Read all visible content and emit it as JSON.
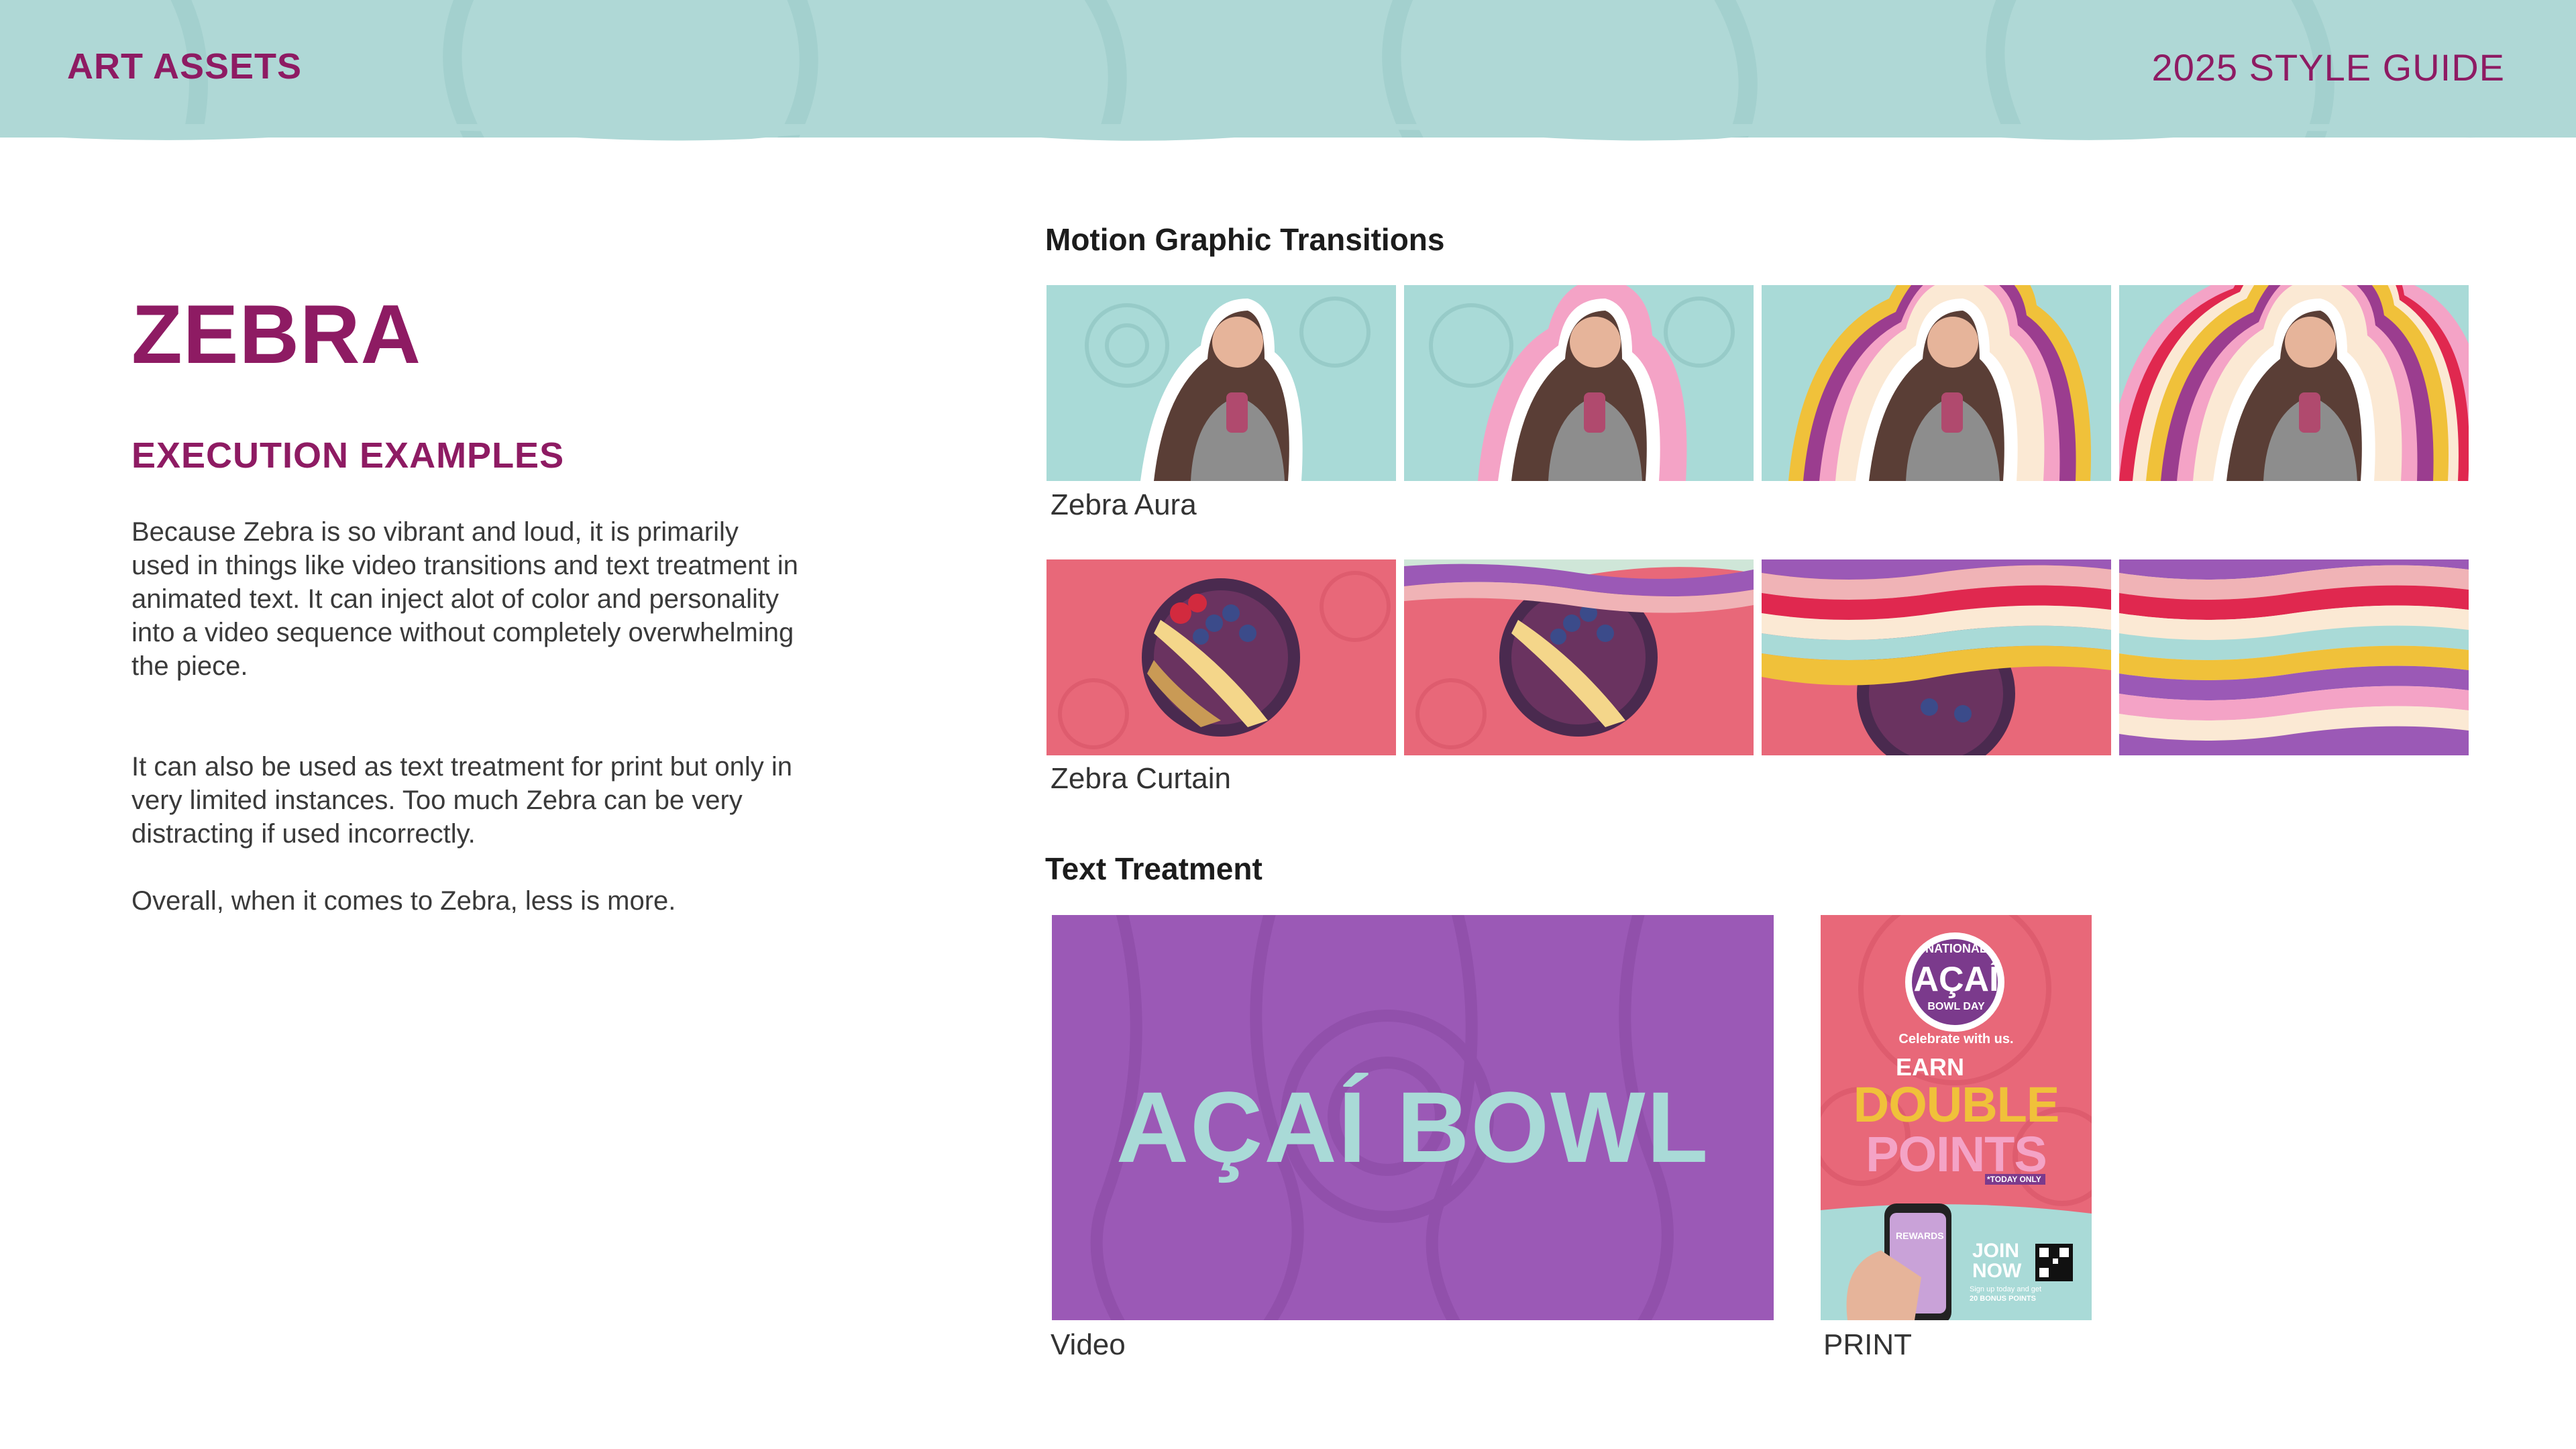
{
  "header": {
    "left_label": "ART ASSETS",
    "right_label": "2025 STYLE GUIDE"
  },
  "intro": {
    "title": "ZEBRA",
    "subtitle": "EXECUTION EXAMPLES",
    "paragraphs": [
      "Because Zebra is so vibrant and loud, it is primarily used in things like video transitions and text treatment in animated text.  It can inject alot of color and personality into a video sequence without completely overwhelming the piece.",
      "It can also be used as text treatment for print but only in very limited instances.  Too much Zebra can be very distracting if used incorrectly.",
      "Overall, when it comes to Zebra, less is more."
    ]
  },
  "motion": {
    "heading": "Motion Graphic Transitions",
    "aura_caption": "Zebra Aura",
    "curtain_caption": "Zebra Curtain"
  },
  "text_treatment": {
    "heading": "Text Treatment",
    "video_caption": "Video",
    "video_text": "AÇAÍ BOWL",
    "print_caption": "PRINT",
    "poster": {
      "badge_top": "NATIONAL",
      "badge_main": "AÇAÍ",
      "badge_bottom": "BOWL DAY",
      "celebrate": "Celebrate with us.",
      "earn": "EARN",
      "double": "DOUBLE",
      "points": "POINTS",
      "today_only": "*TODAY ONLY",
      "join_now_1": "JOIN",
      "join_now_2": "NOW",
      "phone_text": "REWARDS",
      "fine_print_1": "Sign up today and get",
      "fine_print_2": "20 BONUS POINTS"
    }
  },
  "colors": {
    "brand_purple": "#8e1b63",
    "teal": "#afd8d6",
    "pink": "#e86879",
    "violet": "#9b59b6",
    "yellow": "#f0c13a",
    "red": "#e0284f",
    "light_pink": "#f4a3c6",
    "cream": "#fbe9d4"
  }
}
